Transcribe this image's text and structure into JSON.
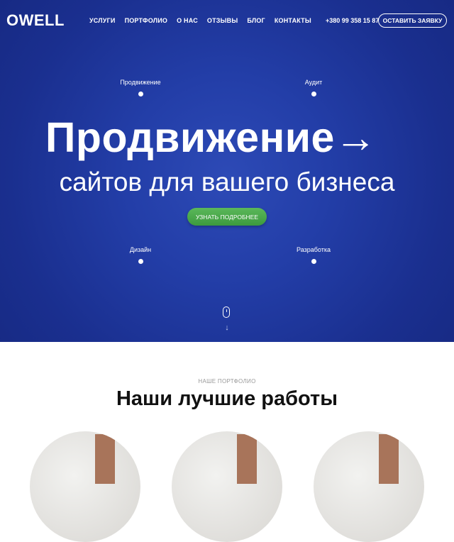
{
  "header": {
    "logo": "OWELL",
    "nav": [
      "УСЛУГИ",
      "ПОРТФОЛИО",
      "О НАС",
      "ОТЗЫВЫ",
      "БЛОГ",
      "КОНТАКТЫ"
    ],
    "phone": "+380 99 358 15 87",
    "cta": "ОСТАВИТЬ ЗАЯВКУ"
  },
  "hero": {
    "nodes": {
      "top_left": "Продвижение",
      "top_right": "Аудит",
      "bottom_left": "Дизайн",
      "bottom_right": "Разработка"
    },
    "headline": "Продвижение",
    "arrow": "→",
    "subheadline": "сайтов для вашего бизнеса",
    "button": "УЗНАТЬ ПОДРОБНЕЕ",
    "scroll_arrow": "↓"
  },
  "portfolio": {
    "eyebrow": "НАШЕ ПОРТФОЛИО",
    "title": "Наши лучшие работы"
  },
  "icons": [
    "mouse-icon",
    "arrow-down-icon",
    "arrow-right-icon"
  ],
  "colors": {
    "hero_bg": "#233ea8",
    "button_green": "#4caf50"
  }
}
